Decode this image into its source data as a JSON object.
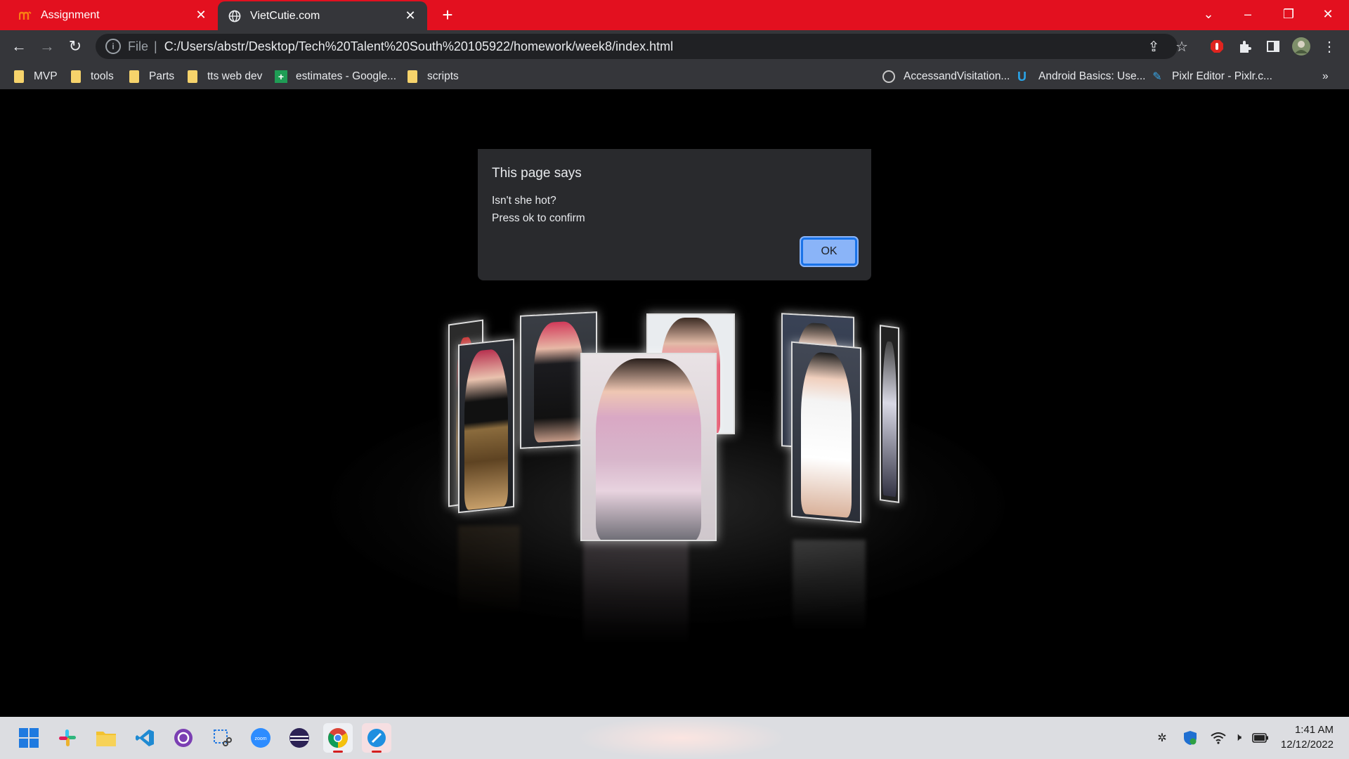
{
  "tabs": [
    {
      "title": "Assignment",
      "icon": "moodle-icon"
    },
    {
      "title": "VietCutie.com",
      "icon": "globe-icon"
    }
  ],
  "address": {
    "scheme": "File",
    "url": "C:/Users/abstr/Desktop/Tech%20Talent%20South%20105922/homework/week8/index.html"
  },
  "bookmarks": [
    {
      "label": "MVP",
      "icon": "folder-icon"
    },
    {
      "label": "tools",
      "icon": "folder-icon"
    },
    {
      "label": "Parts",
      "icon": "folder-icon"
    },
    {
      "label": "tts web dev",
      "icon": "folder-icon"
    },
    {
      "label": "estimates - Google...",
      "icon": "sheets-icon"
    },
    {
      "label": "scripts",
      "icon": "folder-icon"
    },
    {
      "label": "AccessandVisitation...",
      "icon": "globe-icon"
    },
    {
      "label": "Android Basics: Use...",
      "icon": "udacity-icon"
    },
    {
      "label": "Pixlr Editor - Pixlr.c...",
      "icon": "pixlr-icon"
    }
  ],
  "bookmarks_overflow": "»",
  "dialog": {
    "title": "This page says",
    "line1": "Isn't she hot?",
    "line2": "Press ok to confirm",
    "ok_label": "OK"
  },
  "taskbar": {
    "time": "1:41 AM",
    "date": "12/12/2022",
    "apps": [
      "start-icon",
      "slack-icon",
      "file-explorer-icon",
      "vscode-icon",
      "github-desktop-icon",
      "snipping-tool-icon",
      "zoom-icon",
      "eclipse-icon",
      "chrome-icon",
      "app-icon"
    ]
  },
  "colors": {
    "tabstrip": "#e3101f",
    "toolbar": "#35363a",
    "dialog": "#292a2d",
    "ok_button": "#8ab4f8"
  }
}
